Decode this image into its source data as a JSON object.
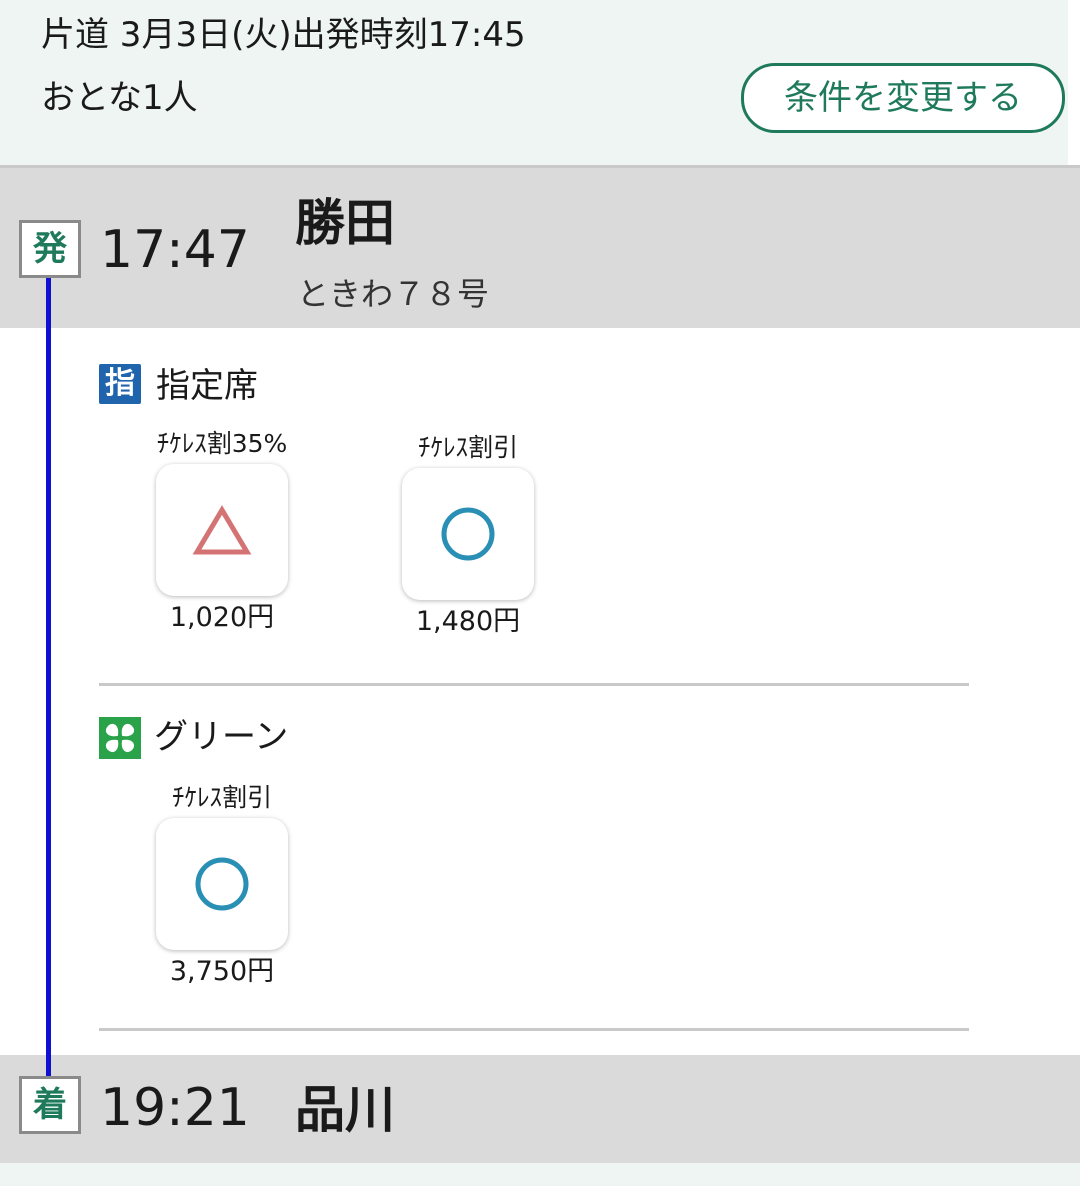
{
  "search_conditions": {
    "trip_info": "片道 3月3日(火)出発時刻17:45",
    "passengers": "おとな1人",
    "change_button_label": "条件を変更する"
  },
  "departure": {
    "badge": "発",
    "time": "17:47",
    "station": "勝田",
    "train": "ときわ７８号"
  },
  "arrival": {
    "badge": "着",
    "time": "19:21",
    "station": "品川"
  },
  "seat_types": [
    {
      "icon_text": "指",
      "icon_color": "#1f64ad",
      "name": "指定席",
      "fares": [
        {
          "label": "ﾁｹﾚｽ割35%",
          "availability": "triangle",
          "availability_color": "#d47373",
          "price": "1,020円"
        },
        {
          "label": "ﾁｹﾚｽ割引",
          "availability": "circle",
          "availability_color": "#2a8fb4",
          "price": "1,480円"
        }
      ]
    },
    {
      "icon_text": "",
      "icon_name": "green-car-clover-icon",
      "icon_color": "#2aa24a",
      "name": "グリーン",
      "fares": [
        {
          "label": "ﾁｹﾚｽ割引",
          "availability": "circle",
          "availability_color": "#2a8fb4",
          "price": "3,750円"
        }
      ]
    }
  ],
  "colors": {
    "header_bg": "#eef5f3",
    "band_bg": "#dadada",
    "accent_green": "#1e7a5a",
    "route_line": "#1010d0"
  }
}
